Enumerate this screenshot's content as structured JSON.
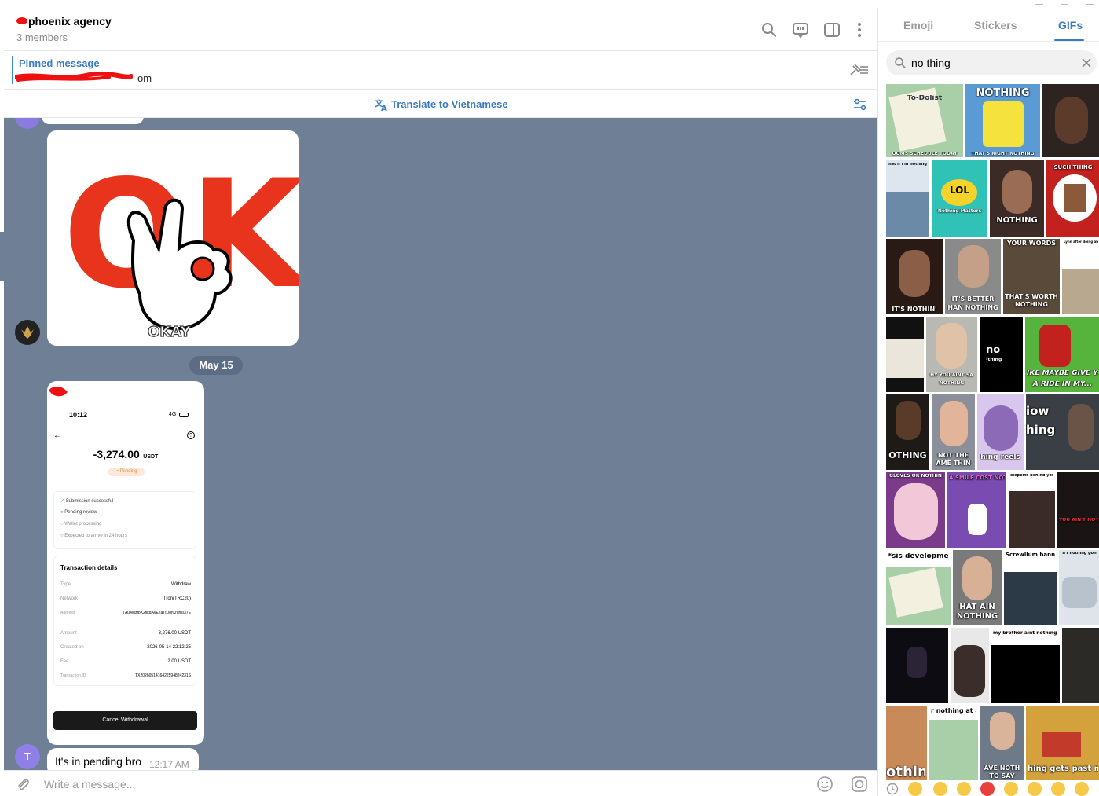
{
  "chat": {
    "title": "phoenix agency",
    "members": "3 members",
    "pinned_title": "Pinned message",
    "pinned_text": "om",
    "translate_label": "Translate to Vietnamese",
    "sticker_caption_ok": "OK",
    "sticker_caption_okay": "OKAY",
    "date_pill": "May 15",
    "sender_initial": "T",
    "text_message": "It's in pending bro",
    "text_time": "12:17 AM",
    "composer_placeholder": "Write a message..."
  },
  "screenshot": {
    "time": "10:12",
    "signal": "4G",
    "amount": "-3,274.00",
    "currency": "USDT",
    "status_badge": "Pending",
    "steps": [
      "Submission successful",
      "Pending review",
      "Wallet processing",
      "Expected to arrive in 24 hours"
    ],
    "details_title": "Transaction details",
    "details": [
      {
        "label": "Type",
        "value": "Withdraw"
      },
      {
        "label": "Network",
        "value": "Tron(TRC20)"
      },
      {
        "label": "Address",
        "value": "TAu4MzfpK2fjkqAvE2aTtD8fCruns|37E"
      },
      {
        "label": "Amount",
        "value": "3,276.00 USDT"
      },
      {
        "label": "Created on",
        "value": "2026-05-14 22:12:25"
      },
      {
        "label": "Fee",
        "value": "2.00 USDT"
      },
      {
        "label": "Transaction ID",
        "value": "TX2026051416422594824231S"
      }
    ],
    "cancel_button": "Cancel Withdrawal"
  },
  "panel": {
    "tabs": [
      "Emoji",
      "Stickers",
      "GIFs"
    ],
    "active_tab": "GIFs",
    "search_value": "no thing",
    "gif_captions": {
      "g1": "To-Dolist",
      "g1b": "OOMS SCHEDULE TODAY",
      "g2": "NOTHING",
      "g2b": "THAT'S RIGHT NOTHING",
      "g4": "hat if I'm nothing",
      "g5a": "LOL",
      "g5b": "Nothing Matters",
      "g6": "NOTHING",
      "g7": "SUCH THING",
      "g8": "IT'S NOTHIN'",
      "g9": "IT'S BETTER",
      "g9b": "HAN NOTHING",
      "g10": "YOUR WORDS",
      "g10b": "THAT'S WORTH",
      "g10c": "NOTHING",
      "g11": "Lynn after doing absolutely nothing",
      "g13": "HY YOU AINT SA",
      "g13b": "NOTHING",
      "g14": "no",
      "g14b": "-thing",
      "g15": "IKE MAYBE GIVE YO",
      "g15b": "A RIDE IN MY...",
      "g16": "OTHING",
      "g17": "NOT THE",
      "g17b": "AME THIN",
      "g18": "hing reels",
      "g19": "iow",
      "g19b": "hing",
      "g20": "GLOVES OR NOTHIN",
      "g21": "A SMILE COST NOTHING",
      "g22": "eleports behind you",
      "g23": "YOU AIN'T NOTHING BUT A LIAR",
      "g24": "*sis developme",
      "g26": "HAT AIN",
      "g26b": "NOTHING",
      "g27": "Screwllum banne",
      "g28": "n't nothing gon",
      "g31": "my brother aint nothing b",
      "g33": "r nothing at a",
      "g34": "AVE NOTH",
      "g34b": "TO SAY",
      "g35": "hing gets past my",
      "g36": "othin"
    }
  },
  "colors": {
    "accent": "#3a7ac0",
    "chat_bg": "#6f7f96",
    "date_pill": "#5c6c84",
    "brand_red": "#e8341c"
  },
  "icons": [
    "search-icon",
    "chat-icon",
    "sidebar-toggle-icon",
    "more-icon",
    "pin-list-icon",
    "translate-icon",
    "settings-icon",
    "attach-icon",
    "emoji-icon",
    "camera-icon",
    "clear-icon"
  ]
}
